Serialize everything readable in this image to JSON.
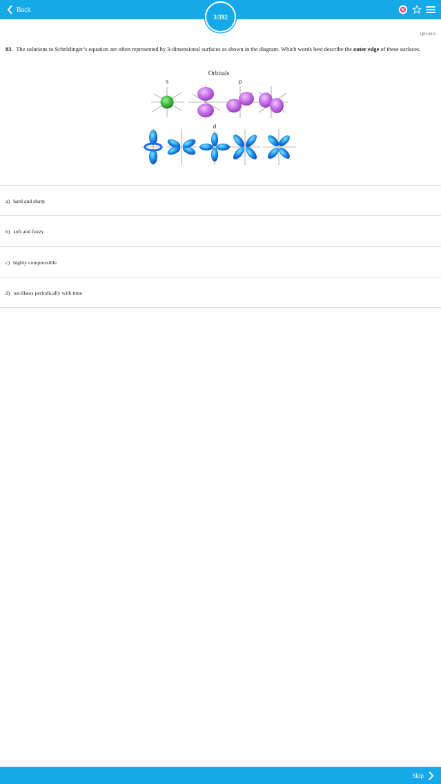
{
  "header": {
    "back_label": "Back",
    "counter": "3/392",
    "icons": [
      "close-circle-icon",
      "star-outline-icon",
      "menu-icon"
    ],
    "accent_color": "#16a9ea"
  },
  "question": {
    "id": "Q03.06.9",
    "number": "83.",
    "text_before": "The solutions to Schrödinger’s equation are often represented by 3-dimensional surfaces as shown in the diagram. Which words best describe the",
    "bold_term": "outer edge",
    "text_after": "of these surfaces."
  },
  "figure": {
    "title": "Orbitals",
    "labels": {
      "s": "s",
      "p": "p",
      "d": "d"
    },
    "colors": {
      "s": "#3db83d",
      "p": "#c36ae6",
      "d": "#1a8de8"
    }
  },
  "choices": [
    {
      "letter": "a)",
      "text": "hard and sharp"
    },
    {
      "letter": "b)",
      "text": "soft and fuzzy"
    },
    {
      "letter": "c)",
      "text": "highly compressible"
    },
    {
      "letter": "d)",
      "text": "oscillates periodically with time"
    }
  ],
  "footer": {
    "skip_label": "Skip"
  }
}
